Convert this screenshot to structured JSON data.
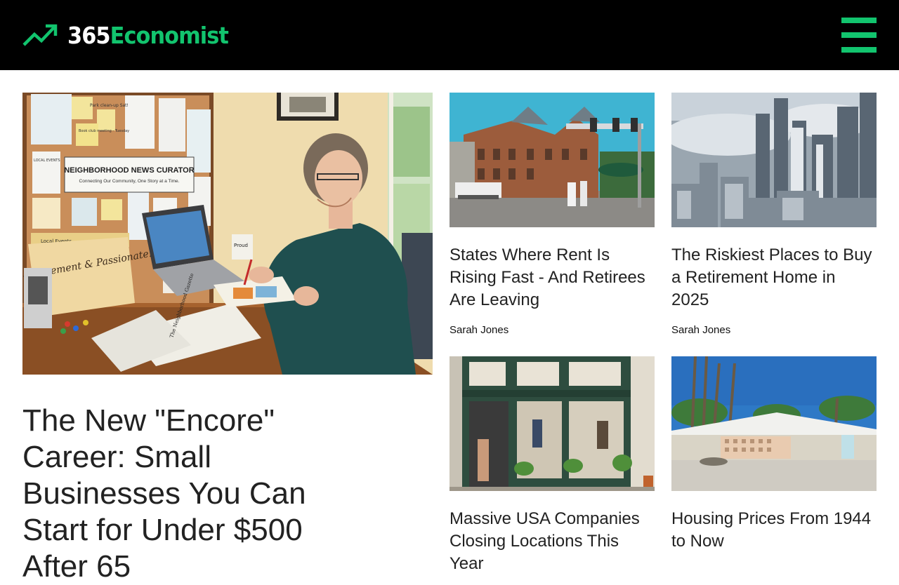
{
  "header": {
    "logo_prefix": "365",
    "logo_name": "Economist",
    "brand_color": "#12c46e",
    "menu_icon": "hamburger-menu-icon"
  },
  "feature": {
    "title": "The New \"Encore\" Career: Small Businesses You Can Start for Under $500 After 65",
    "image": {
      "board_title": "NEIGHBORHOOD NEWS CURATOR",
      "board_subtitle": "Connecting Our Community, One Story at a Time.",
      "note_park": "Park clean-up Sat!",
      "note_book": "Book club meeting - Tuesday",
      "tag_local": "LOCAL EVENTS",
      "folder_label": "Local Events",
      "folder_sign": "Post-Retirement & Passionate!",
      "newspaper": "The Neighborhood Gazette",
      "mug": "Proud"
    }
  },
  "articles": [
    {
      "title": "States Where Rent Is Rising Fast - And Retirees Are Leaving",
      "author": "Sarah Jones"
    },
    {
      "title": "The Riskiest Places to Buy a Retirement Home in 2025",
      "author": "Sarah Jones"
    },
    {
      "title": "Massive USA Companies Closing Locations This Year",
      "author": ""
    },
    {
      "title": "Housing Prices From 1944 to Now",
      "author": ""
    }
  ]
}
